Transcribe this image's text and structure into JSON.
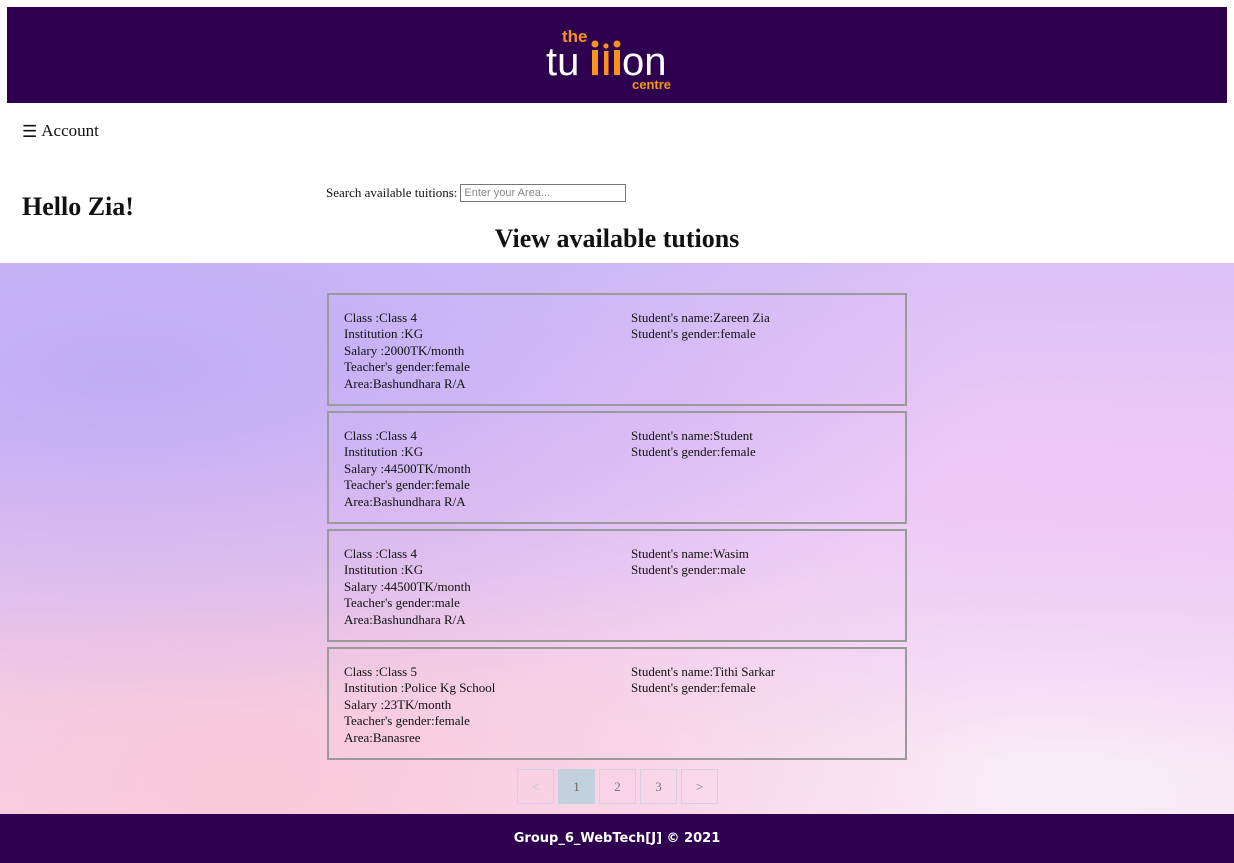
{
  "header": {
    "logo_top": "the",
    "logo_main": "tuition",
    "logo_sub": "centre"
  },
  "account": {
    "icon": "☰",
    "label": "Account"
  },
  "greeting": "Hello Zia!",
  "search": {
    "label": "Search available tuitions:",
    "placeholder": "Enter your Area...",
    "value": ""
  },
  "section_title": "View available tutions",
  "tuitions": [
    {
      "class_line": "Class :Class 4",
      "institution_line": "Institution :KG",
      "salary_line": "Salary :2000TK/month",
      "teacher_gender_line": "Teacher's gender:female",
      "area_line": "Area:Bashundhara R/A",
      "student_name_line": "Student's name:Zareen Zia",
      "student_gender_line": "Student's gender:female"
    },
    {
      "class_line": "Class :Class 4",
      "institution_line": "Institution :KG",
      "salary_line": "Salary :44500TK/month",
      "teacher_gender_line": "Teacher's gender:female",
      "area_line": "Area:Bashundhara R/A",
      "student_name_line": "Student's name:Student",
      "student_gender_line": "Student's gender:female"
    },
    {
      "class_line": "Class :Class 4",
      "institution_line": "Institution :KG",
      "salary_line": "Salary :44500TK/month",
      "teacher_gender_line": "Teacher's gender:male",
      "area_line": "Area:Bashundhara R/A",
      "student_name_line": "Student's name:Wasim",
      "student_gender_line": "Student's gender:male"
    },
    {
      "class_line": "Class :Class 5",
      "institution_line": "Institution :Police Kg School",
      "salary_line": "Salary :23TK/month",
      "teacher_gender_line": "Teacher's gender:female",
      "area_line": "Area:Banasree",
      "student_name_line": "Student's name:Tithi Sarkar",
      "student_gender_line": "Student's gender:female"
    }
  ],
  "pagination": {
    "prev": "<",
    "pages": [
      "1",
      "2",
      "3"
    ],
    "current": "1",
    "next": ">"
  },
  "footer": {
    "text": "Group_6_WebTech[J] © 2021"
  },
  "colors": {
    "header_bg": "#2e004f",
    "logo_orange": "#f7941d",
    "active_page": "#c2d1dc"
  }
}
